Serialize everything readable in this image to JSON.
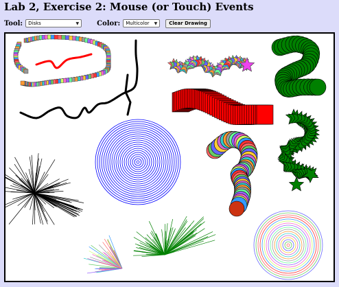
{
  "title": "Lab 2, Exercise 2: Mouse (or Touch) Events",
  "toolbar": {
    "tool_label": "Tool:",
    "tool_value": "Disks",
    "color_label": "Color:",
    "color_value": "Multicolor",
    "clear_label": "Clear Drawing"
  },
  "colors": {
    "page_background": "#dcdcfa",
    "red": "#ff0000",
    "green": "#008000",
    "blue": "#0000ff",
    "black": "#000000",
    "magenta": "#ee44ee"
  },
  "icons": {
    "select_arrow": "chevron-down-icon"
  }
}
